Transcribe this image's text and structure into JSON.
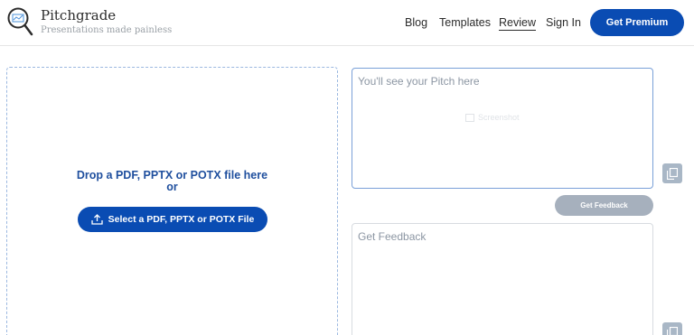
{
  "header": {
    "brand": "Pitchgrade",
    "tagline": "Presentations made painless",
    "nav": {
      "blog": "Blog",
      "templates": "Templates",
      "review": "Review",
      "signin": "Sign In"
    },
    "premium_label": "Get Premium"
  },
  "upload": {
    "drop_line1": "Drop a PDF, PPTX or POTX file here",
    "drop_line2": "or",
    "select_label": "Select a PDF, PPTX or POTX File"
  },
  "pitch": {
    "placeholder": "You'll see your Pitch here",
    "watermark": "Screenshot"
  },
  "feedback": {
    "button_label": "Get Feedback",
    "placeholder": "Get Feedback"
  },
  "icons": {
    "logo": "magnifier-chart-icon",
    "upload": "upload-icon",
    "copy": "copy-icon"
  },
  "colors": {
    "primary": "#0a4cb3",
    "drop_text": "#1f4f9e",
    "disabled_button": "#a6b0bd",
    "copy_button": "#a9b7c6"
  }
}
